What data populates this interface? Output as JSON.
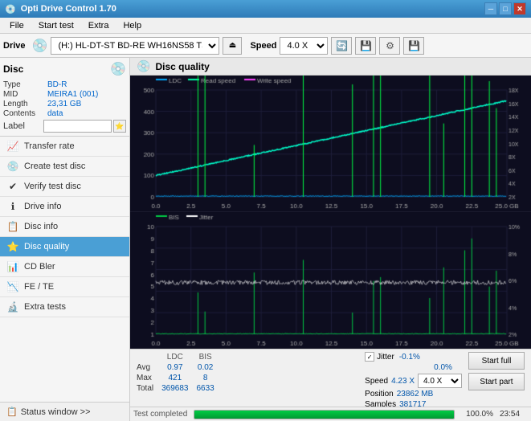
{
  "app": {
    "title": "Opti Drive Control 1.70",
    "icon": "💿"
  },
  "titlebar": {
    "minimize": "─",
    "maximize": "□",
    "close": "✕"
  },
  "menu": {
    "items": [
      "File",
      "Start test",
      "Extra",
      "Help"
    ]
  },
  "toolbar": {
    "drive_label": "Drive",
    "drive_value": "(H:)  HL-DT-ST BD-RE  WH16NS58 TST4",
    "speed_label": "Speed",
    "speed_value": "4.0 X"
  },
  "disc": {
    "label": "Disc",
    "type_label": "Type",
    "type_value": "BD-R",
    "mid_label": "MID",
    "mid_value": "MEIRA1 (001)",
    "length_label": "Length",
    "length_value": "23,31 GB",
    "contents_label": "Contents",
    "contents_value": "data",
    "label_label": "Label",
    "label_value": ""
  },
  "nav": {
    "items": [
      {
        "id": "transfer-rate",
        "label": "Transfer rate",
        "icon": "📈"
      },
      {
        "id": "create-test-disc",
        "label": "Create test disc",
        "icon": "💿"
      },
      {
        "id": "verify-test-disc",
        "label": "Verify test disc",
        "icon": "✔"
      },
      {
        "id": "drive-info",
        "label": "Drive info",
        "icon": "ℹ"
      },
      {
        "id": "disc-info",
        "label": "Disc info",
        "icon": "📋"
      },
      {
        "id": "disc-quality",
        "label": "Disc quality",
        "icon": "⭐",
        "active": true
      },
      {
        "id": "cd-bler",
        "label": "CD Bler",
        "icon": "📊"
      },
      {
        "id": "fe-te",
        "label": "FE / TE",
        "icon": "📉"
      },
      {
        "id": "extra-tests",
        "label": "Extra tests",
        "icon": "🔬"
      }
    ],
    "status_window": "Status window >>"
  },
  "disc_quality": {
    "title": "Disc quality",
    "legend": {
      "ldc": "LDC",
      "read_speed": "Read speed",
      "write_speed": "Write speed",
      "bis": "BIS",
      "jitter": "Jitter"
    }
  },
  "stats": {
    "headers": [
      "",
      "LDC",
      "BIS"
    ],
    "rows": [
      {
        "label": "Avg",
        "ldc": "0.97",
        "bis": "0.02"
      },
      {
        "label": "Max",
        "ldc": "421",
        "bis": "8"
      },
      {
        "label": "Total",
        "ldc": "369683",
        "bis": "6633"
      }
    ],
    "jitter": {
      "label": "Jitter",
      "checked": true,
      "value": "-0.1%",
      "max_value": "0.0%"
    },
    "speed": {
      "label": "Speed",
      "value": "4.23 X",
      "select_value": "4.0 X"
    },
    "position": {
      "label": "Position",
      "value": "23862 MB"
    },
    "samples": {
      "label": "Samples",
      "value": "381717"
    },
    "buttons": {
      "start_full": "Start full",
      "start_part": "Start part"
    }
  },
  "progress": {
    "status": "Test completed",
    "percent": "100.0%",
    "fill_width": "100",
    "time": "23:54"
  },
  "chart1": {
    "y_max": 500,
    "y_labels": [
      "500",
      "400",
      "300",
      "200",
      "100",
      "0"
    ],
    "right_labels": [
      "18X",
      "16X",
      "14X",
      "12X",
      "10X",
      "8X",
      "6X",
      "4X",
      "2X"
    ],
    "x_labels": [
      "0.0",
      "2.5",
      "5.0",
      "7.5",
      "10.0",
      "12.5",
      "15.0",
      "17.5",
      "20.0",
      "22.5",
      "25.0 GB"
    ]
  },
  "chart2": {
    "y_max": 10,
    "y_labels": [
      "10",
      "9",
      "8",
      "7",
      "6",
      "5",
      "4",
      "3",
      "2",
      "1"
    ],
    "right_labels": [
      "10%",
      "8%",
      "6%",
      "4%",
      "2%"
    ],
    "x_labels": [
      "0.0",
      "2.5",
      "5.0",
      "7.5",
      "10.0",
      "12.5",
      "15.0",
      "17.5",
      "20.0",
      "22.5",
      "25.0 GB"
    ]
  },
  "colors": {
    "ldc": "#00aaff",
    "read_speed": "#00ffaa",
    "write_speed": "#ff00ff",
    "bis": "#00cc44",
    "jitter": "#ffffff",
    "grid": "#2a2a4a",
    "chart_bg": "#0a0a1e",
    "active_nav": "#4a9fd5",
    "accent": "#0066cc"
  }
}
